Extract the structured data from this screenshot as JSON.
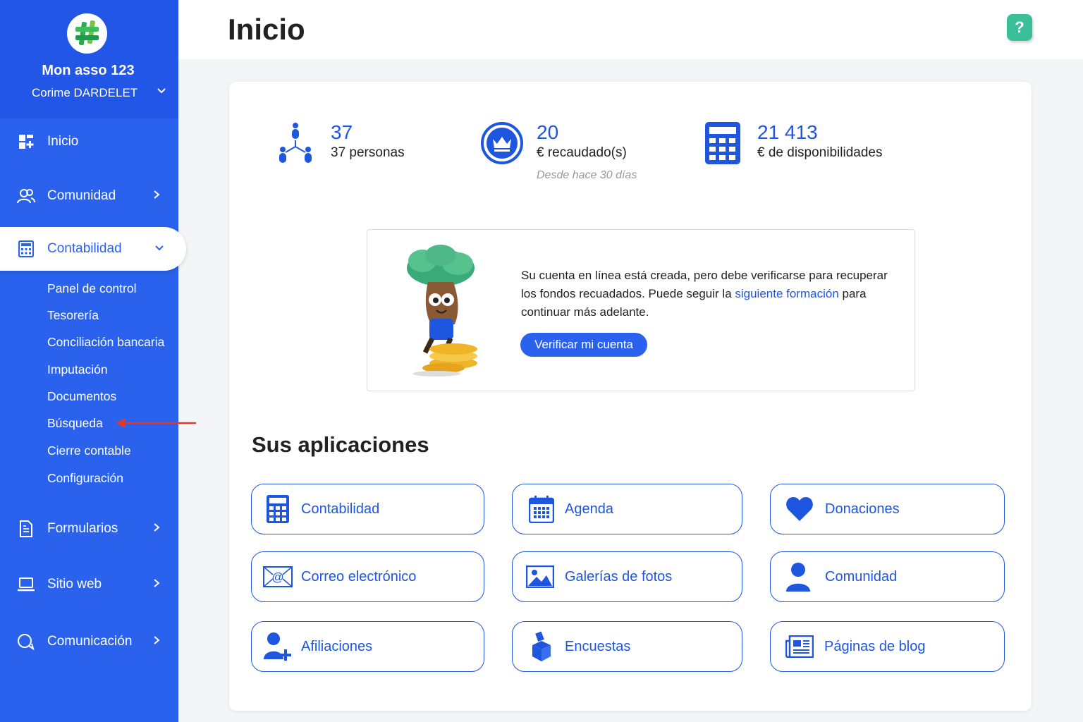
{
  "sidebar": {
    "org_name": "Mon asso 123",
    "user_name": "Corime DARDELET",
    "items": [
      {
        "label": "Inicio",
        "icon": "dashboard-icon"
      },
      {
        "label": "Comunidad",
        "icon": "users-icon"
      },
      {
        "label": "Contabilidad",
        "icon": "calculator-icon"
      },
      {
        "label": "Formularios",
        "icon": "document-icon"
      },
      {
        "label": "Sitio web",
        "icon": "laptop-icon"
      },
      {
        "label": "Comunicación",
        "icon": "chat-icon"
      }
    ],
    "subitems": [
      "Panel de control",
      "Tesorería",
      "Conciliación bancaria",
      "Imputación",
      "Documentos",
      "Búsqueda",
      "Cierre contable",
      "Configuración"
    ]
  },
  "header": {
    "title": "Inicio",
    "help_label": "?"
  },
  "stats": [
    {
      "value": "37",
      "label": "37 personas",
      "icon": "network-people-icon"
    },
    {
      "value": "20",
      "label": "€ recaudado(s)",
      "note": "Desde hace 30 días",
      "icon": "crown-circle-icon"
    },
    {
      "value": "21 413",
      "label": "€ de disponibilidades",
      "icon": "calculator-icon"
    }
  ],
  "notice": {
    "text_before": "Su cuenta en línea está creada, pero debe verificarse para recuperar los fondos recuadados. Puede seguir la ",
    "link": "siguiente formación",
    "text_after": " para continuar más adelante.",
    "button": "Verificar mi cuenta"
  },
  "apps": {
    "title": "Sus aplicaciones",
    "items": [
      {
        "label": "Contabilidad",
        "icon": "calculator-icon"
      },
      {
        "label": "Agenda",
        "icon": "calendar-icon"
      },
      {
        "label": "Donaciones",
        "icon": "heart-icon"
      },
      {
        "label": "Correo electrónico",
        "icon": "email-icon"
      },
      {
        "label": "Galerías de fotos",
        "icon": "image-icon"
      },
      {
        "label": "Comunidad",
        "icon": "user-icon"
      },
      {
        "label": "Afiliaciones",
        "icon": "add-user-icon"
      },
      {
        "label": "Encuestas",
        "icon": "ballot-box-icon"
      },
      {
        "label": "Páginas de blog",
        "icon": "newspaper-icon"
      }
    ]
  },
  "colors": {
    "sidebar": "#2a62ee",
    "accent": "#1e56e0",
    "help": "#3bbf9b",
    "arrow": "#e0392b"
  }
}
